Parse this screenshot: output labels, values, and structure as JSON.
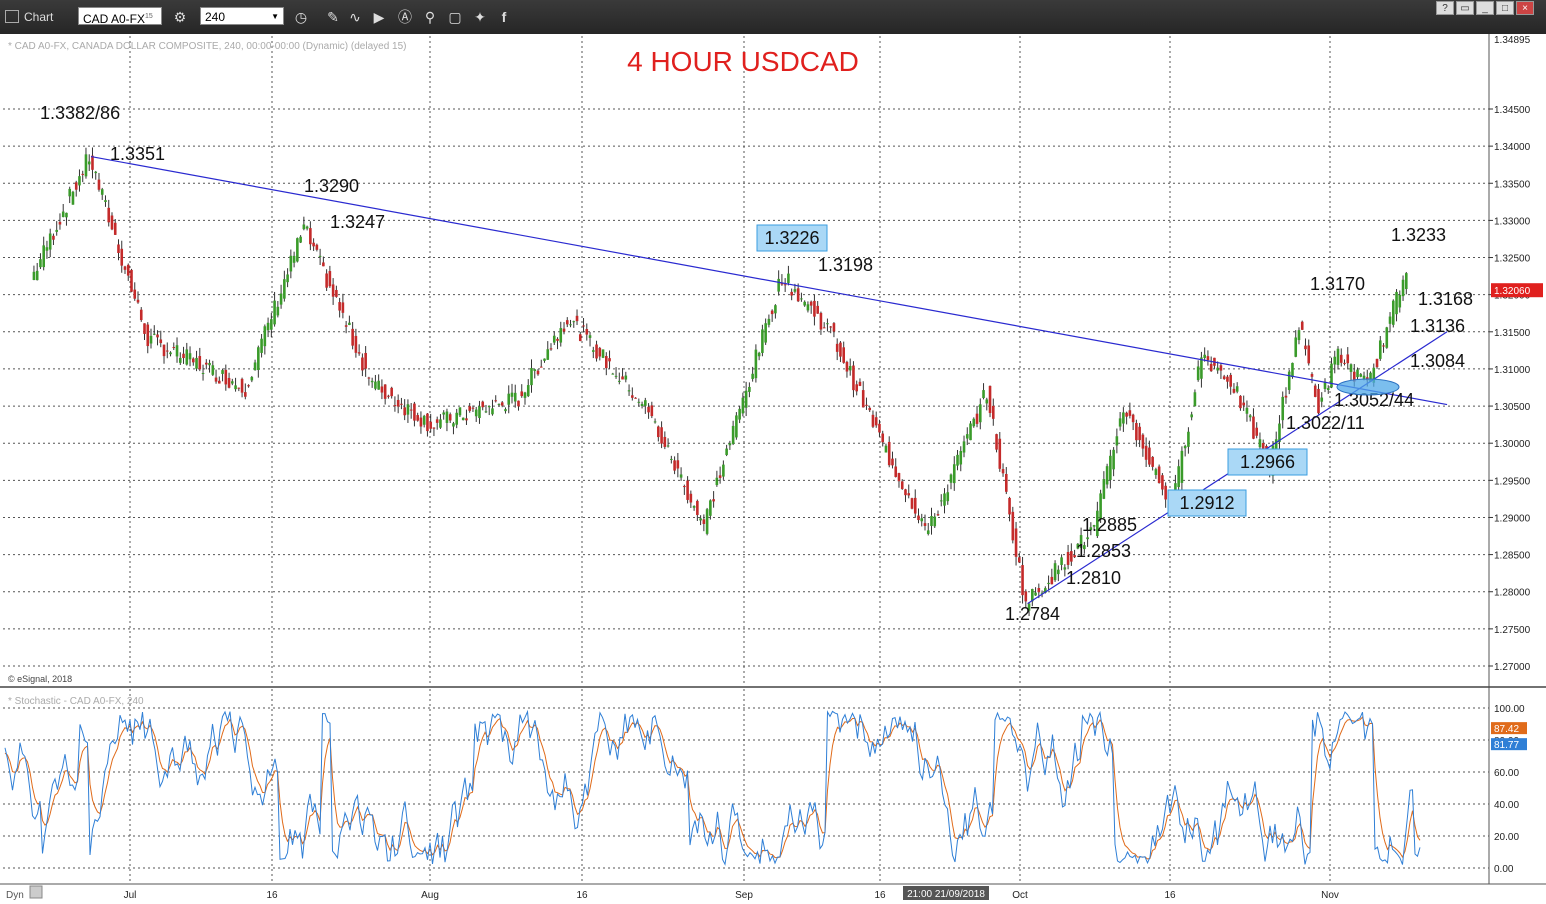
{
  "toolbar": {
    "app_title": "Chart",
    "symbol": "CAD A0-FX",
    "symbol_superscript": "15",
    "interval": "240"
  },
  "main_panel": {
    "header": "* CAD A0-FX, CANADA DOLLAR COMPOSITE, 240, 00:00-00:00 (Dynamic) (delayed 15)",
    "title": "4 HOUR USDCAD",
    "credit": "© eSignal, 2018",
    "price_ticks": [
      "1.34500",
      "1.34000",
      "1.33500",
      "1.33000",
      "1.32500",
      "1.32000",
      "1.31500",
      "1.31000",
      "1.30500",
      "1.30000",
      "1.29500",
      "1.29000",
      "1.28500",
      "1.28000",
      "1.27500",
      "1.27000"
    ],
    "top_price": "1.34895",
    "current_price": "1.32060"
  },
  "stoch_panel": {
    "header": "* Stochastic - CAD A0-FX, 240",
    "ticks": [
      "100.00",
      "80.00",
      "60.00",
      "40.00",
      "20.00",
      "0.00"
    ],
    "k_value": "87.42",
    "d_value": "81.77"
  },
  "xaxis": {
    "labels": [
      "Jul",
      "16",
      "Aug",
      "16",
      "Sep",
      "16",
      "Oct",
      "16",
      "Nov"
    ],
    "cursor_time": "21:00 21/09/2018",
    "left_label": "Dyn"
  },
  "annotations": {
    "plain": [
      "1.3382/86",
      "1.3351",
      "1.3290",
      "1.3247",
      "1.3198",
      "1.3233",
      "1.3170",
      "1.3168",
      "1.3136",
      "1.3084",
      "1.3052/44",
      "1.3022/11",
      "1.2885",
      "1.2853",
      "1.2810",
      "1.2784"
    ],
    "boxed": [
      "1.3226",
      "1.2966",
      "1.2912"
    ]
  },
  "chart_data": {
    "type": "line",
    "title": "4 HOUR USDCAD",
    "timeframe": "240",
    "x_range": [
      "2018-06-21",
      "2018-11-09"
    ],
    "ylim": [
      1.2675,
      1.34895
    ],
    "x": [
      "2018-06-21",
      "2018-06-27",
      "2018-07-03",
      "2018-07-13",
      "2018-07-19",
      "2018-07-26",
      "2018-08-01",
      "2018-08-10",
      "2018-08-15",
      "2018-08-23",
      "2018-08-29",
      "2018-09-06",
      "2018-09-11",
      "2018-09-17",
      "2018-09-21",
      "2018-09-27",
      "2018-10-01",
      "2018-10-08",
      "2018-10-11",
      "2018-10-16",
      "2018-10-19",
      "2018-10-22",
      "2018-10-26",
      "2018-10-29",
      "2018-10-31",
      "2018-11-02",
      "2018-11-05",
      "2018-11-09"
    ],
    "series": [
      {
        "values": [
          1.322,
          1.3386,
          1.314,
          1.3075,
          1.329,
          1.308,
          1.3025,
          1.306,
          1.317,
          1.305,
          1.289,
          1.3226,
          1.315,
          1.298,
          1.288,
          1.307,
          1.2784,
          1.2885,
          1.305,
          1.2912,
          1.312,
          1.3085,
          1.2966,
          1.316,
          1.305,
          1.312,
          1.3075,
          1.3233
        ]
      }
    ],
    "trendlines": [
      {
        "from": [
          "2018-06-27",
          1.3386
        ],
        "to": [
          "2018-11-13",
          1.3052
        ]
      },
      {
        "from": [
          "2018-10-01",
          1.2784
        ],
        "to": [
          "2018-11-13",
          1.315
        ]
      }
    ],
    "stochastic": {
      "ylim": [
        0,
        100
      ],
      "levels": [
        20,
        80
      ],
      "last_k": 87.42,
      "last_d": 81.77
    }
  }
}
